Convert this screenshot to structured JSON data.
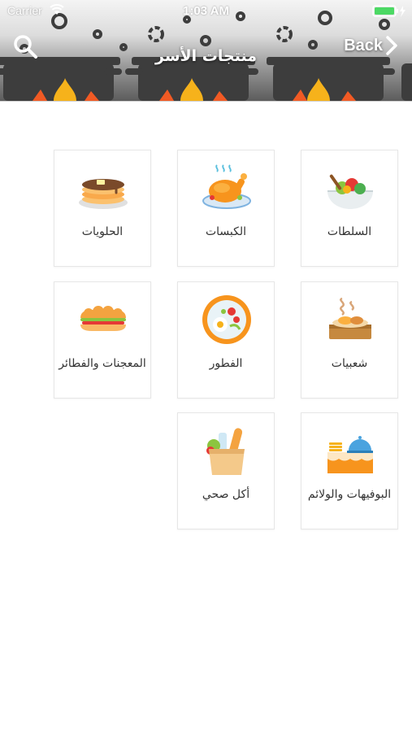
{
  "status_bar": {
    "carrier": "Carrier",
    "time": "1:03 AM"
  },
  "nav": {
    "title": "منتجات الأسر",
    "back_label": "Back"
  },
  "categories": [
    {
      "label": "السلطات",
      "icon": "salad-bowl-icon"
    },
    {
      "label": "الكبسات",
      "icon": "roast-chicken-icon"
    },
    {
      "label": "الحلويات",
      "icon": "pancakes-icon"
    },
    {
      "label": "شعبيات",
      "icon": "traditional-dish-icon"
    },
    {
      "label": "الفطور",
      "icon": "breakfast-plate-icon"
    },
    {
      "label": "المعجنات والفطائر",
      "icon": "sandwich-icon"
    },
    {
      "label": "البوفيهات والولائم",
      "icon": "buffet-icon"
    },
    {
      "label": "أكل صحي",
      "icon": "grocery-bag-icon"
    }
  ],
  "colors": {
    "accent_orange": "#f7941d",
    "header_dark": "#3b3b3b",
    "flame": "#f6b21b"
  }
}
